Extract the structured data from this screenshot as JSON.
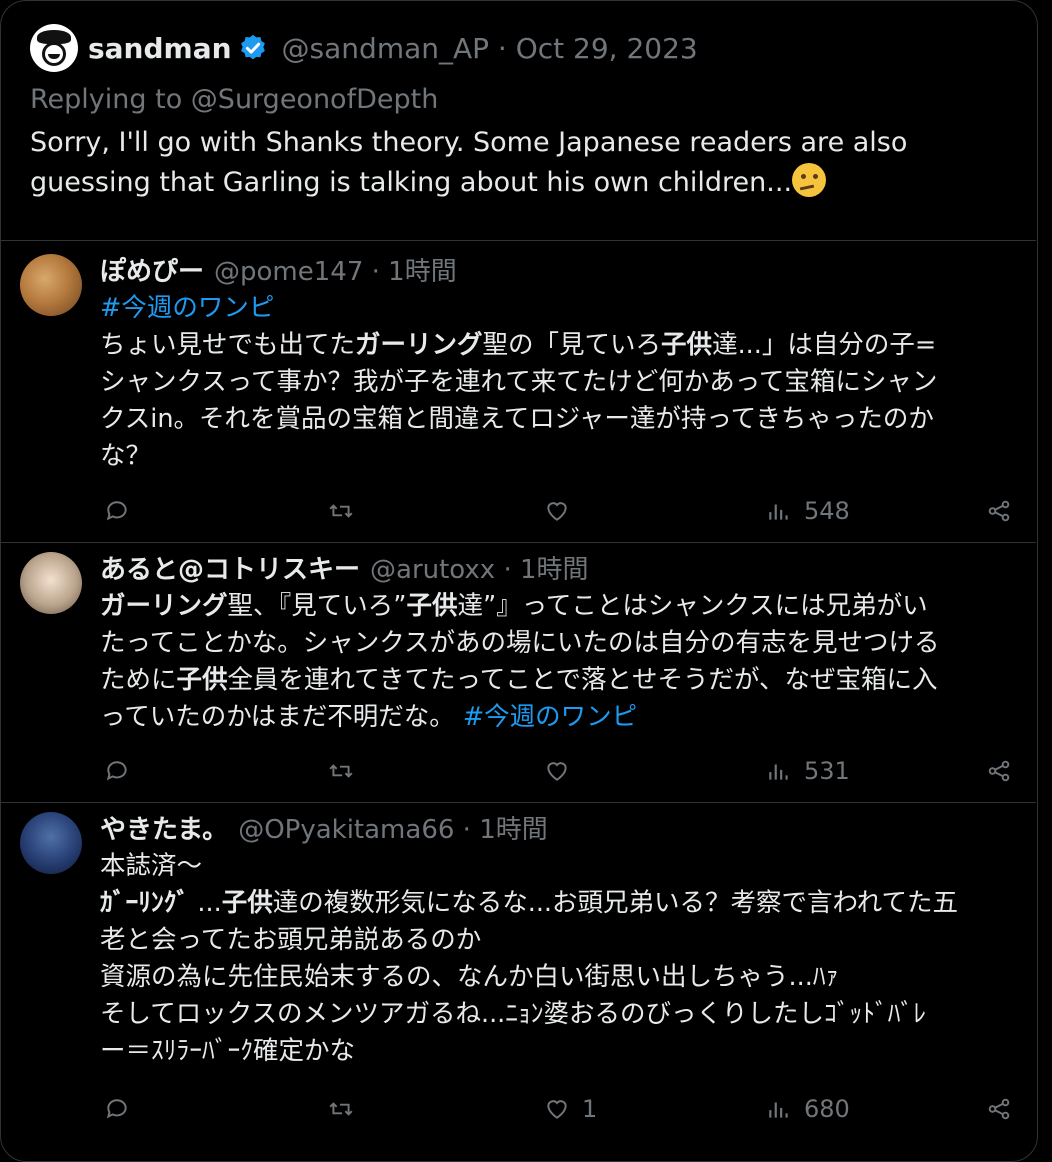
{
  "tweet": {
    "name": "sandman",
    "handle_date": "@sandman_AP · Oct 29, 2023",
    "replying": "Replying to @SurgeonofDepth",
    "line1": "Sorry, I'll go with Shanks theory. Some Japanese readers are also",
    "line2": "guessing that Garling is talking about his own children..."
  },
  "replies": [
    {
      "name": "ぽめぴー",
      "meta": "@pome147 · 1時間",
      "tag": "#今週のワンピ",
      "lines": [
        [
          "ちょい見せでも出てた",
          "ガーリング",
          "聖の「見ていろ",
          "子供",
          "達...」は自分の子="
        ],
        [
          "シャンクスって事か？我が子を連れて来てたけど何かあって宝箱にシャン"
        ],
        [
          "クスin。それを賞品の宝箱と間違えてロジャー達が持ってきちゃったのか"
        ],
        [
          "な？"
        ]
      ],
      "views": "548",
      "likes": ""
    },
    {
      "name": "あると@コトリスキー",
      "meta": "@arutoxx · 1時間",
      "lines": [
        [
          "ガーリング",
          "聖、『見ていろ”",
          "子供",
          "達”』ってことはシャンクスには兄弟がい"
        ],
        [
          "たってことかな。シャンクスがあの場にいたのは自分の有志を見せつける"
        ],
        [
          "ために",
          "子供",
          "全員を連れてきてたってことで落とせそうだが、なぜ宝箱に入"
        ],
        [
          "っていたのかはまだ不明だな。 ",
          "#今週のワンピ"
        ]
      ],
      "views": "531",
      "likes": ""
    },
    {
      "name": "やきたま。",
      "meta": "@OPyakitama66 · 1時間",
      "lines": [
        [
          "本誌済〜"
        ],
        [
          "ｶﾞｰﾘﾝｸﾞ",
          " ...",
          "子供",
          "達の複数形気になるな...お頭兄弟いる？考察で言われてた五"
        ],
        [
          "老と会ってたお頭兄弟説あるのか"
        ],
        [
          "資源の為に先住民始末するの、なんか白い街思い出しちゃう...ﾊｧ"
        ],
        [
          "そしてロックスのメンツアガるね...ﾆｮﾝ婆おるのびっくりしたしｺﾞｯﾄﾞﾊﾞﾚ"
        ],
        [
          "ー＝ｽﾘﾗｰﾊﾞｰｸ確定かな"
        ]
      ],
      "views": "680",
      "likes": "1"
    }
  ]
}
